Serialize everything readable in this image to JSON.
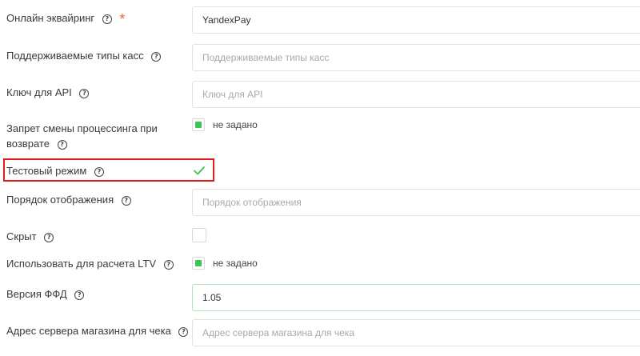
{
  "fields": {
    "acquiring": {
      "label": "Онлайн эквайринг",
      "value": "YandexPay",
      "required_mark": "*"
    },
    "cash_types": {
      "label": "Поддерживаемые типы касс",
      "placeholder": "Поддерживаемые типы касс"
    },
    "api_key": {
      "label": "Ключ для API",
      "placeholder": "Ключ для API"
    },
    "processing_ban": {
      "label_line1": "Запрет смены процессинга при",
      "label_line2": "возврате",
      "status": "не задано"
    },
    "test_mode": {
      "label": "Тестовый режим",
      "checked": true
    },
    "display_order": {
      "label": "Порядок отображения",
      "placeholder": "Порядок отображения"
    },
    "hidden": {
      "label": "Скрыт",
      "checked": false
    },
    "ltv": {
      "label": "Использовать для расчета LTV",
      "status": "не задано"
    },
    "ffd_version": {
      "label": "Версия ФФД",
      "value": "1.05"
    },
    "server_address": {
      "label": "Адрес сервера магазина для чека",
      "placeholder": "Адрес сервера магазина для чека"
    }
  },
  "help_icon_glyph": "?",
  "colors": {
    "accent_green": "#3ec254",
    "highlight_red": "#e01b1b",
    "required_orange": "#f0672e"
  }
}
